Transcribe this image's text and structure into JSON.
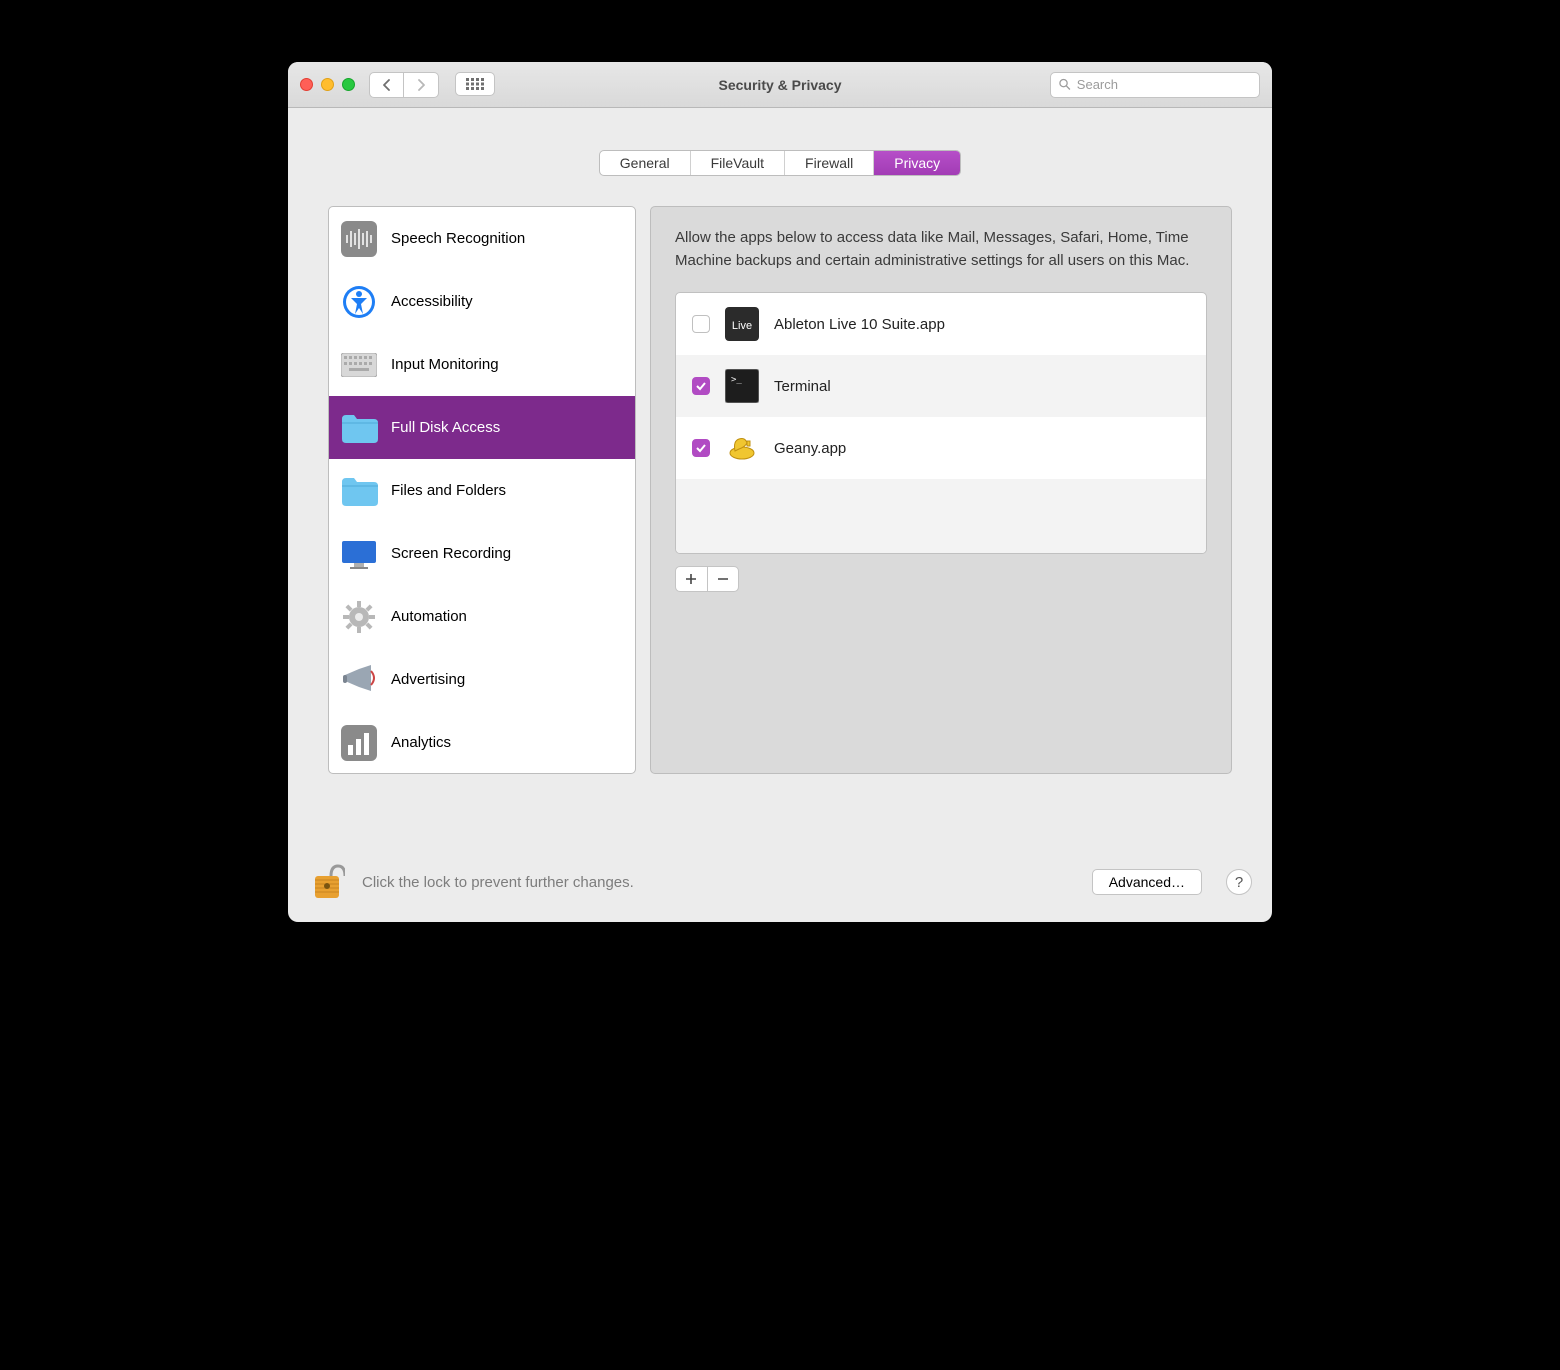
{
  "window": {
    "title": "Security & Privacy"
  },
  "search": {
    "placeholder": "Search"
  },
  "tabs": [
    {
      "label": "General"
    },
    {
      "label": "FileVault"
    },
    {
      "label": "Firewall"
    },
    {
      "label": "Privacy",
      "active": true
    }
  ],
  "sidebar": {
    "items": [
      {
        "label": "Speech Recognition",
        "icon": "waveform-icon"
      },
      {
        "label": "Accessibility",
        "icon": "accessibility-icon"
      },
      {
        "label": "Input Monitoring",
        "icon": "keyboard-icon"
      },
      {
        "label": "Full Disk Access",
        "icon": "folder-icon",
        "selected": true
      },
      {
        "label": "Files and Folders",
        "icon": "folder-icon"
      },
      {
        "label": "Screen Recording",
        "icon": "display-icon"
      },
      {
        "label": "Automation",
        "icon": "gear-icon"
      },
      {
        "label": "Advertising",
        "icon": "megaphone-icon"
      },
      {
        "label": "Analytics",
        "icon": "chart-icon"
      }
    ]
  },
  "main": {
    "description": "Allow the apps below to access data like Mail, Messages, Safari, Home, Time Machine backups and certain administrative settings for all users on this Mac.",
    "apps": [
      {
        "name": "Ableton Live 10 Suite.app",
        "checked": false,
        "icon": "ableton-icon"
      },
      {
        "name": "Terminal",
        "checked": true,
        "icon": "terminal-icon"
      },
      {
        "name": "Geany.app",
        "checked": true,
        "icon": "geany-icon"
      }
    ]
  },
  "footer": {
    "lock_text": "Click the lock to prevent further changes.",
    "advanced_label": "Advanced…",
    "help_label": "?"
  }
}
